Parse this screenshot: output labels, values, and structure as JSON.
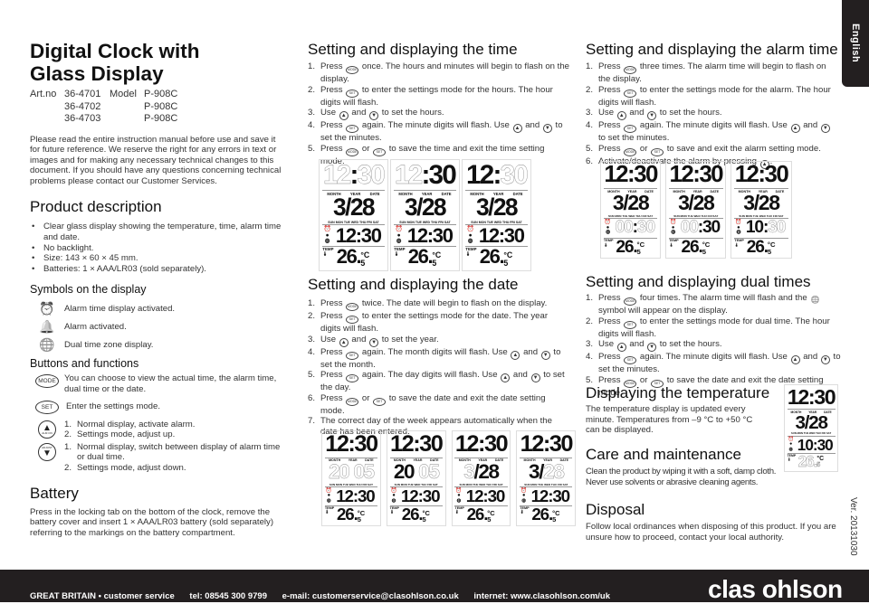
{
  "lang_tab": "English",
  "version": "Ver. 20131030",
  "col1": {
    "title_l1": "Digital Clock with",
    "title_l2": "Glass Display",
    "art": [
      [
        "Art.no",
        "36-4701",
        "Model",
        "P-908C"
      ],
      [
        "",
        "36-4702",
        "",
        "P-908C"
      ],
      [
        "",
        "36-4703",
        "",
        "P-908C"
      ]
    ],
    "intro": "Please read the entire instruction manual before use and save it for future reference. We reserve the right for any errors in text or images and for making any necessary technical changes to this document. If you should have any questions concerning technical problems please contact our Customer Services.",
    "product_heading": "Product description",
    "product_items": [
      "Clear glass display showing the temperature, time, alarm time and date.",
      "No backlight.",
      "Size: 143 × 60 × 45 mm.",
      "Batteries: 1 × AAA/LR03 (sold separately)."
    ],
    "symbols_heading": "Symbols on the display",
    "symbols": [
      {
        "icon": "alarm-clock-icon",
        "glyph": "⏰",
        "text": "Alarm time display activated."
      },
      {
        "icon": "bell-icon",
        "glyph": "🔔",
        "text": "Alarm activated."
      },
      {
        "icon": "globe-icon",
        "glyph": "🌐",
        "text": "Dual time zone display."
      }
    ],
    "buttons_heading": "Buttons and functions",
    "buttons": {
      "mode": {
        "label": "MODE",
        "text": "You can choose to view the actual time, the alarm time, dual time or the date."
      },
      "set": {
        "label": "SET",
        "text": "Enter the settings mode."
      },
      "up": {
        "glyph": "▲",
        "sub": "ALM ON",
        "items": [
          "Normal display, activate alarm.",
          "Settings mode, adjust up."
        ]
      },
      "down": {
        "glyph": "▼",
        "sub": "ADJUST",
        "items": [
          "Normal display, switch between display of alarm time or dual time.",
          "Settings mode, adjust down."
        ]
      }
    },
    "battery_heading": "Battery",
    "battery_text": "Press in the locking tab on the bottom of the clock, remove the battery cover and insert 1 × AAA/LR03 battery (sold separately) referring to the markings on the battery compartment."
  },
  "icons": {
    "mode": "MODE",
    "set": "SET",
    "up": "▲",
    "down": "▼",
    "dual": "🌐"
  },
  "lcd_labels": {
    "month": "MONTH",
    "year": "YEAR",
    "date": "DATE",
    "weekdays": "SUN MON TUE WED THU FRI SAT",
    "temp": "TEMP",
    "unit": "°C"
  },
  "time_section": {
    "heading": "Setting and displaying the time",
    "steps": [
      "Press {MODE} once. The hours and minutes will begin to flash on the display.",
      "Press {SET} to enter the settings mode for the hours. The hour digits will flash.",
      "Use {UP} and {DOWN} to set the hours.",
      "Press {SET} again. The minute digits will flash. Use {UP} and {DOWN} to set the minutes.",
      "Press {MODE} or {SET} to save the time and exit the time setting mode."
    ],
    "displays": [
      {
        "top": {
          "h": "12",
          "m": "30",
          "flash": "hm"
        },
        "date": {
          "a": "3",
          "sep": "/",
          "b": "28",
          "flash": ""
        },
        "low": {
          "h": "12",
          "m": "30",
          "flash": ""
        },
        "temp": {
          "v": "26",
          "d": "5"
        }
      },
      {
        "top": {
          "h": "12",
          "m": "30",
          "flash": "h"
        },
        "date": {
          "a": "3",
          "sep": "/",
          "b": "28",
          "flash": ""
        },
        "low": {
          "h": "12",
          "m": "30",
          "flash": ""
        },
        "temp": {
          "v": "26",
          "d": "5"
        }
      },
      {
        "top": {
          "h": "12",
          "m": "30",
          "flash": "m"
        },
        "date": {
          "a": "3",
          "sep": "/",
          "b": "28",
          "flash": ""
        },
        "low": {
          "h": "12",
          "m": "30",
          "flash": ""
        },
        "temp": {
          "v": "26",
          "d": "5"
        }
      }
    ]
  },
  "date_section": {
    "heading": "Setting and displaying the date",
    "steps": [
      "Press {MODE} twice. The date will begin to flash on the display.",
      "Press {SET} to enter the settings mode for the date. The year digits will flash.",
      "Use {UP} and {DOWN} to set the year.",
      "Press {SET} again. The month digits will flash. Use {UP} and {DOWN} to set the month.",
      "Press {SET} again. The day digits will flash. Use {UP} and {DOWN} to set the day.",
      "Press {MODE} or {SET} to save the date and exit the date setting mode.",
      "The correct day of the week appears automatically when the date has been entered."
    ],
    "displays": [
      {
        "top": {
          "h": "12",
          "m": "30",
          "flash": ""
        },
        "date": {
          "a": "20",
          "sep": " ",
          "b": "05",
          "flash": "ab"
        },
        "low": {
          "h": "12",
          "m": "30",
          "flash": ""
        },
        "temp": {
          "v": "26",
          "d": "5"
        }
      },
      {
        "top": {
          "h": "12",
          "m": "30",
          "flash": ""
        },
        "date": {
          "a": "20",
          "sep": " ",
          "b": "05",
          "flash": "b"
        },
        "low": {
          "h": "12",
          "m": "30",
          "flash": ""
        },
        "temp": {
          "v": "26",
          "d": "5"
        }
      },
      {
        "top": {
          "h": "12",
          "m": "30",
          "flash": ""
        },
        "date": {
          "a": "3",
          "sep": "/",
          "b": "28",
          "flash": "a"
        },
        "low": {
          "h": "12",
          "m": "30",
          "flash": ""
        },
        "temp": {
          "v": "26",
          "d": "5"
        }
      },
      {
        "top": {
          "h": "12",
          "m": "30",
          "flash": ""
        },
        "date": {
          "a": "3",
          "sep": "/",
          "b": "28",
          "flash": "b"
        },
        "low": {
          "h": "12",
          "m": "30",
          "flash": ""
        },
        "temp": {
          "v": "26",
          "d": "5"
        }
      }
    ]
  },
  "alarm_section": {
    "heading": "Setting and displaying the alarm time",
    "steps": [
      "Press {MODE} three times. The alarm time will begin to flash on the display.",
      "Press {SET} to enter the settings mode for the alarm. The hour digits will flash.",
      "Use {UP} and {DOWN} to set the hours.",
      "Press {SET} again. The minute digits will flash. Use {UP} and {DOWN} to set the minutes.",
      "Press {MODE} or {SET} to save and exit the alarm setting mode.",
      "Activate/deactivate the alarm by pressing {UP}."
    ],
    "displays": [
      {
        "top": {
          "h": "12",
          "m": "30",
          "flash": ""
        },
        "date": {
          "a": "3",
          "sep": "/",
          "b": "28",
          "flash": ""
        },
        "low": {
          "h": "00",
          "m": "30",
          "flash": "hm"
        },
        "temp": {
          "v": "26",
          "d": "5"
        }
      },
      {
        "top": {
          "h": "12",
          "m": "30",
          "flash": ""
        },
        "date": {
          "a": "3",
          "sep": "/",
          "b": "28",
          "flash": ""
        },
        "low": {
          "h": "00",
          "m": "30",
          "flash": "h"
        },
        "temp": {
          "v": "26",
          "d": "5"
        }
      },
      {
        "top": {
          "h": "12",
          "m": "30",
          "flash": ""
        },
        "date": {
          "a": "3",
          "sep": "/",
          "b": "28",
          "flash": ""
        },
        "low": {
          "h": "10",
          "m": "30",
          "flash": "m"
        },
        "temp": {
          "v": "26",
          "d": "5"
        }
      }
    ]
  },
  "dual_section": {
    "heading": "Setting and displaying dual times",
    "steps": [
      "Press {MODE} four times. The alarm time will flash and the {DUAL} symbol will appear on the display.",
      "Press {SET} to enter the settings mode for dual time. The hour digits will flash.",
      "Use {UP} and {DOWN} to set the hours.",
      "Press {SET} again. The minute digits will flash. Use {UP} and {DOWN} to set the minutes.",
      "Press {MODE} or {SET} to save the date and exit the date setting mode."
    ]
  },
  "temp_section": {
    "heading": "Displaying the temperature",
    "text": "The temperature display is updated every minute. Temperatures from –9 °C to +50 °C can be displayed.",
    "display": {
      "top": {
        "h": "12",
        "m": "30",
        "flash": ""
      },
      "date": {
        "a": "3",
        "sep": "/",
        "b": "28",
        "flash": ""
      },
      "low": {
        "h": "10",
        "m": "30",
        "flash": ""
      },
      "temp": {
        "v": "26",
        "d": "5",
        "flash": true
      }
    }
  },
  "care_section": {
    "heading": "Care and maintenance",
    "text": "Clean the product by wiping it with a soft, damp cloth. Never use solvents or abrasive cleaning agents."
  },
  "disposal_section": {
    "heading": "Disposal",
    "text": "Follow local ordinances when disposing of this product. If you are unsure how to proceed, contact your local authority."
  },
  "footer": {
    "country": "GREAT BRITAIN • customer service",
    "tel": "tel: 08545 300 9799",
    "email": "e-mail: customerservice@clasohlson.co.uk",
    "internet": "internet: www.clasohlson.com/uk",
    "logo": "clas ohlson"
  },
  "colors": {
    "footer_bg": "#231f20",
    "text": "#222222"
  }
}
